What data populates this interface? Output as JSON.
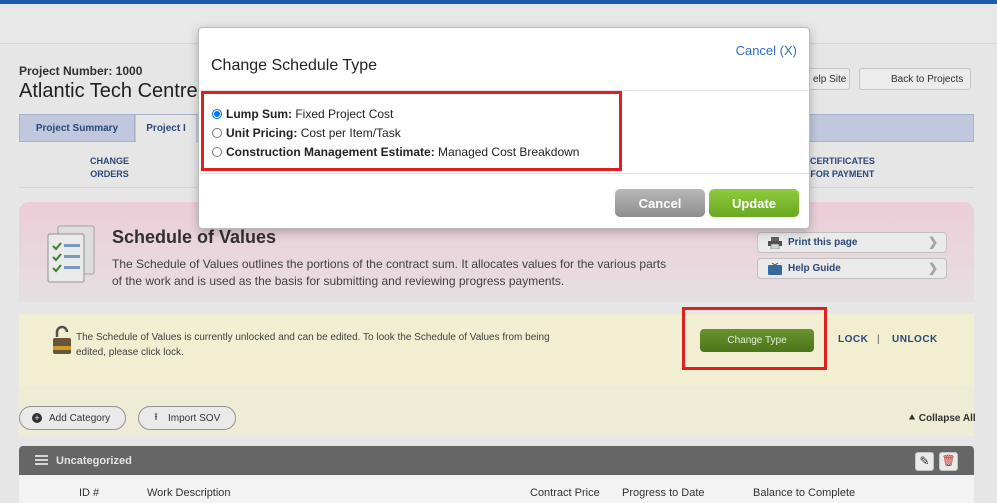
{
  "header": {
    "project_number": "Project Number: 1000",
    "project_name": "Atlantic Tech Centre",
    "help_site": "elp Site",
    "back_to_projects": "Back to Projects"
  },
  "tabs": [
    "Project Summary",
    "Project I"
  ],
  "subnav": {
    "change_orders_line1": "CHANGE",
    "change_orders_line2": "ORDERS",
    "certificates_line1": "CERTIFICATES",
    "certificates_line2": "FOR PAYMENT"
  },
  "sov": {
    "title": "Schedule of Values",
    "description": "The Schedule of Values outlines the portions of the contract sum. It allocates values for the various parts of the work and is used as the basis for submitting and reviewing progress payments.",
    "print_page": "Print this page",
    "help_guide": "Help Guide"
  },
  "lock": {
    "message": "The Schedule of Values is currently unlocked and can be edited. To look the Schedule of Values from being edited, please click lock.",
    "change_type": "Change Type",
    "lock_label": "LOCK",
    "separator": "|",
    "unlock_label": "UNLOCK"
  },
  "toolbar": {
    "add_category": "Add Category",
    "import_sov": "Import SOV",
    "collapse_all": "Collapse All"
  },
  "category": {
    "name": "Uncategorized",
    "columns": [
      "ID #",
      "Work Description",
      "Contract Price",
      "Progress to Date",
      "Balance to Complete"
    ]
  },
  "modal": {
    "title": "Change Schedule Type",
    "close": "Cancel (X)",
    "options": [
      {
        "label": "Lump Sum:",
        "desc": "Fixed Project Cost",
        "selected": true
      },
      {
        "label": "Unit Pricing:",
        "desc": "Cost per Item/Task",
        "selected": false
      },
      {
        "label": "Construction Management Estimate:",
        "desc": "Managed Cost Breakdown",
        "selected": false
      }
    ],
    "cancel": "Cancel",
    "update": "Update"
  },
  "colors": {
    "accent_blue": "#1d5fb8",
    "update_green": "#7bbb2f",
    "highlight_red": "#e02020"
  }
}
